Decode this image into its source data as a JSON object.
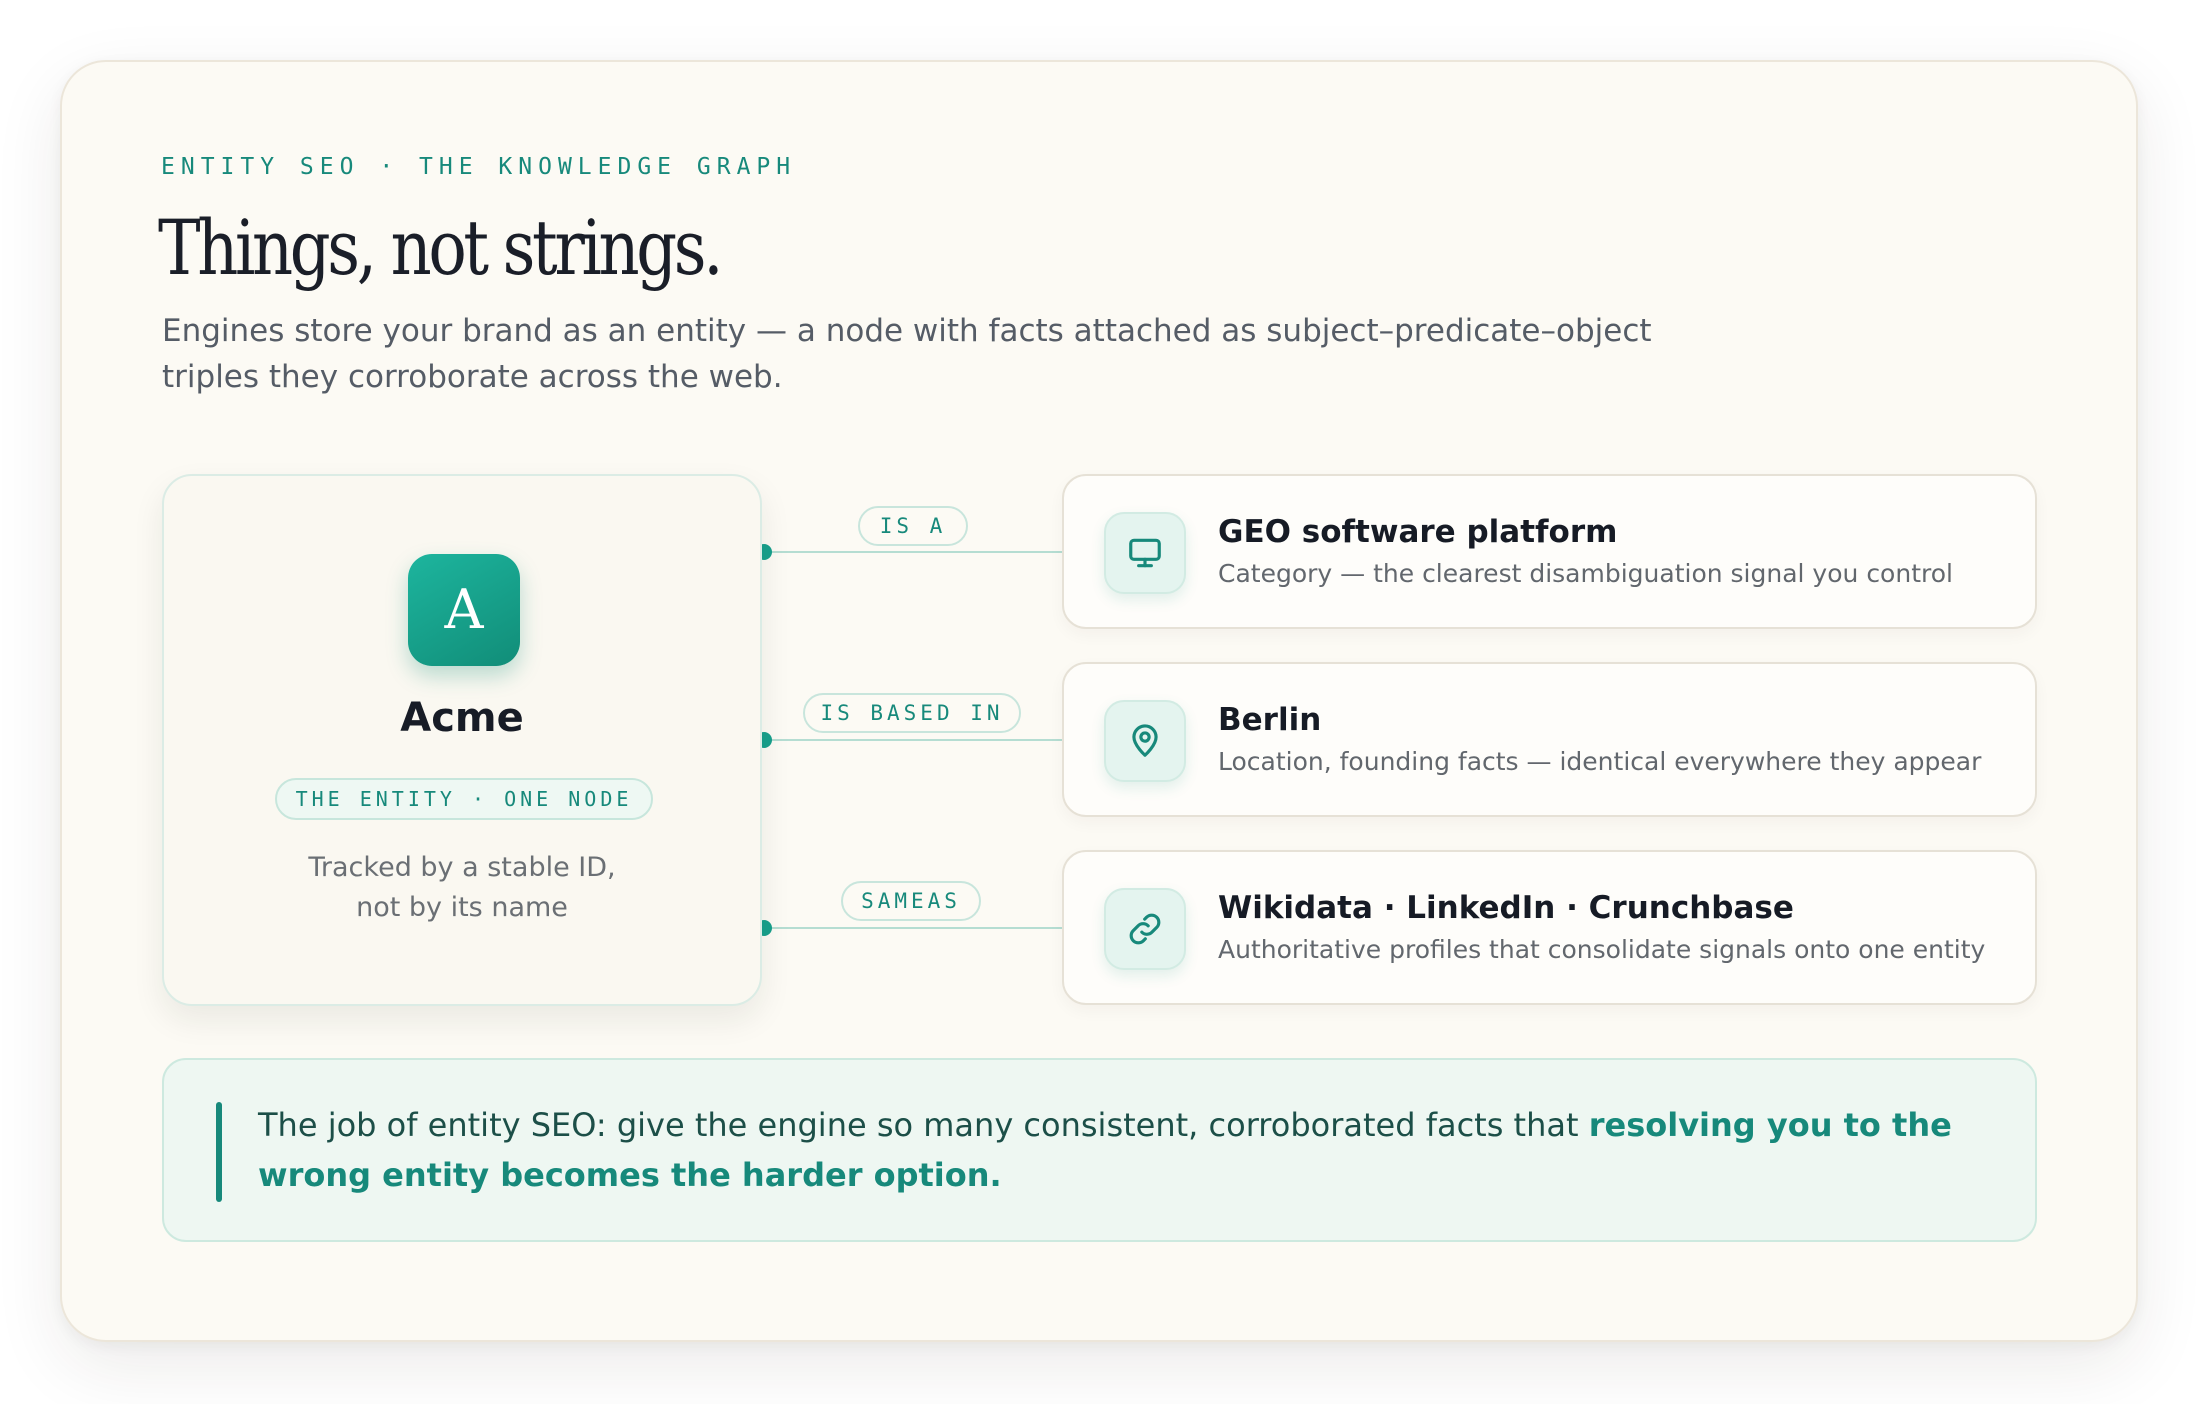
{
  "header": {
    "eyebrow": "ENTITY SEO · THE KNOWLEDGE GRAPH",
    "title": "Things, not strings.",
    "subtitle": "Engines store your brand as an entity — a node with facts attached as subject–predicate–object triples they corroborate across the web."
  },
  "entity": {
    "avatar_letter": "A",
    "name": "Acme",
    "pill": "THE ENTITY · ONE NODE",
    "note_line1": "Tracked by a stable ID,",
    "note_line2": "not by its name"
  },
  "facts": [
    {
      "predicate": "IS A",
      "icon": "monitor-icon",
      "title": "GEO software platform",
      "description": "Category — the clearest disambiguation signal you control"
    },
    {
      "predicate": "IS BASED IN",
      "icon": "map-pin-icon",
      "title": "Berlin",
      "description": "Location, founding facts — identical everywhere they appear"
    },
    {
      "predicate": "SAMEAS",
      "icon": "link-icon",
      "title": "Wikidata · LinkedIn · Crunchbase",
      "description": "Authoritative profiles that consolidate signals onto one entity"
    }
  ],
  "callout": {
    "text": "The job of entity SEO: give the engine so many consistent, corroborated facts that ",
    "emphasis": "resolving you to the wrong entity becomes the harder option."
  },
  "colors": {
    "accent": "#17897b",
    "background": "#fcfaf4",
    "callout_background": "#eef7f2"
  }
}
